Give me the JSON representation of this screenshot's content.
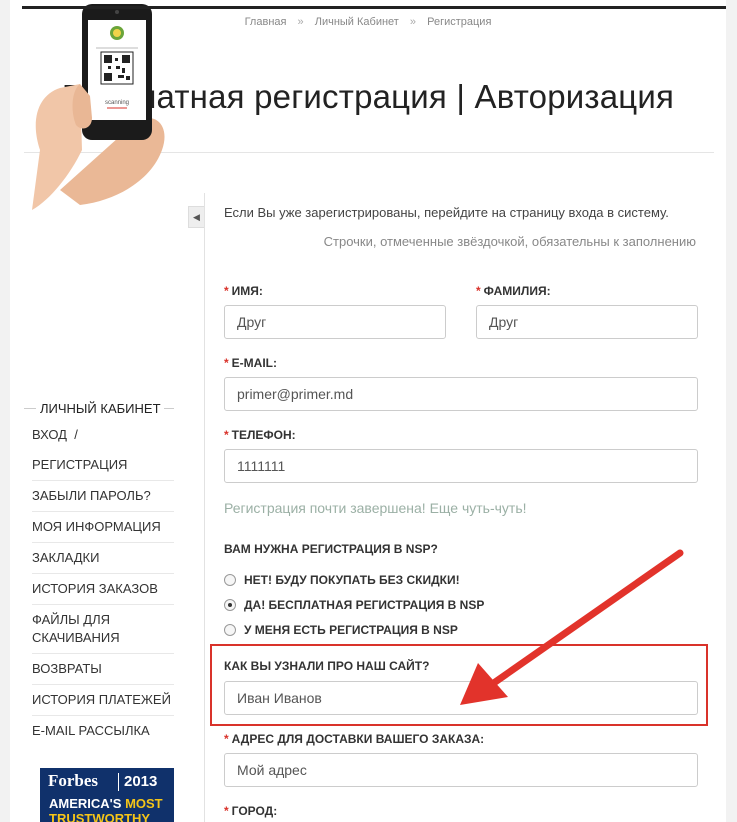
{
  "breadcrumb": {
    "home": "Главная",
    "account": "Личный Кабинет",
    "current": "Регистрация",
    "separator": "»"
  },
  "page_title": "Бесплатная регистрация | Авторизация",
  "sidebar": {
    "heading": "ЛИЧНЫЙ КАБИНЕТ",
    "items": [
      {
        "label": "ВХОД  /"
      },
      {
        "label": "РЕГИСТРАЦИЯ"
      },
      {
        "label": "ЗАБЫЛИ ПАРОЛЬ?"
      },
      {
        "label": "МОЯ ИНФОРМАЦИЯ"
      },
      {
        "label": "ЗАКЛАДКИ"
      },
      {
        "label": "ИСТОРИЯ ЗАКАЗОВ"
      },
      {
        "label": "ФАЙЛЫ ДЛЯ СКАЧИВАНИЯ"
      },
      {
        "label": "ВОЗВРАТЫ"
      },
      {
        "label": "ИСТОРИЯ ПЛАТЕЖЕЙ"
      },
      {
        "label": "E-MAIL РАССЫЛКА"
      }
    ],
    "phone_caption": "scanning",
    "forbes": {
      "brand": "Forbes",
      "year": "2013",
      "line1_a": "AMERICA'S",
      "line1_b": "MOST",
      "line2": "TRUSTWORTHY"
    }
  },
  "form": {
    "intro": "Если Вы уже зарегистрированы, перейдите на страницу входа в систему.",
    "required_note": "Строчки, отмеченные звёздочкой, обязательны к заполнению",
    "required_star": "*",
    "first_name": {
      "label": "ИМЯ:",
      "value": "Друг"
    },
    "last_name": {
      "label": "ФАМИЛИЯ:",
      "value": "Друг"
    },
    "email": {
      "label": "E-MAIL:",
      "value": "primer@primer.md"
    },
    "phone": {
      "label": "ТЕЛЕФОН:",
      "value": "1111111"
    },
    "hint": "Регистрация почти завершена! Еще чуть-чуть!",
    "nsp_question": "ВАМ НУЖНА РЕГИСТРАЦИЯ В NSP?",
    "nsp_options": [
      {
        "label": "НЕТ! БУДУ ПОКУПАТЬ БЕЗ СКИДКИ!",
        "checked": false
      },
      {
        "label": "ДА! БЕСПЛАТНАЯ РЕГИСТРАЦИЯ В NSP",
        "checked": true
      },
      {
        "label": "У МЕНЯ ЕСТЬ РЕГИСТРАЦИЯ В NSP",
        "checked": false
      }
    ],
    "referral": {
      "label": "КАК ВЫ УЗНАЛИ ПРО НАШ САЙТ?",
      "value": "Иван Иванов"
    },
    "address": {
      "label": "АДРЕС ДЛЯ ДОСТАВКИ ВАШЕГО ЗАКАЗА:",
      "value": "Мой адрес"
    },
    "city": {
      "label": "ГОРОД:"
    }
  },
  "colors": {
    "accent_red": "#d9322a",
    "hint_green": "#9bb0a5",
    "forbes_blue": "#10316b"
  }
}
